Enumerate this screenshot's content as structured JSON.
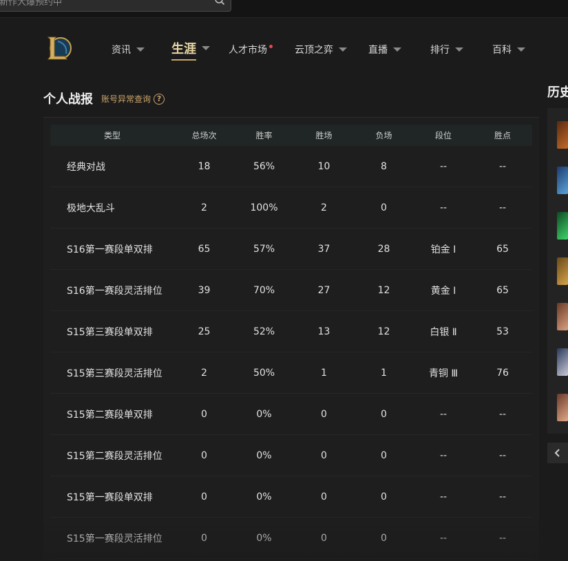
{
  "search": {
    "placeholder": "新作大爆预约中"
  },
  "nav": {
    "items": [
      {
        "label": "资讯"
      },
      {
        "label": "生涯"
      },
      {
        "label": "人才市场"
      },
      {
        "label": "云顶之弈"
      },
      {
        "label": "直播"
      },
      {
        "label": "排行"
      },
      {
        "label": "百科"
      }
    ]
  },
  "page": {
    "title": "个人战报",
    "account_link": "账号异常查询",
    "help_icon_text": "?",
    "right_title": "历史"
  },
  "table": {
    "headers": [
      "类型",
      "总场次",
      "胜率",
      "胜场",
      "负场",
      "段位",
      "胜点"
    ],
    "rows": [
      [
        "经典对战",
        "18",
        "56%",
        "10",
        "8",
        "--",
        "--"
      ],
      [
        "极地大乱斗",
        "2",
        "100%",
        "2",
        "0",
        "--",
        "--"
      ],
      [
        "S16第一赛段单双排",
        "65",
        "57%",
        "37",
        "28",
        "铂金 Ⅰ",
        "65"
      ],
      [
        "S16第一赛段灵活排位",
        "39",
        "70%",
        "27",
        "12",
        "黄金 Ⅰ",
        "65"
      ],
      [
        "S15第三赛段单双排",
        "25",
        "52%",
        "13",
        "12",
        "白银 Ⅱ",
        "53"
      ],
      [
        "S15第三赛段灵活排位",
        "2",
        "50%",
        "1",
        "1",
        "青铜 Ⅲ",
        "76"
      ],
      [
        "S15第二赛段单双排",
        "0",
        "0%",
        "0",
        "0",
        "--",
        "--"
      ],
      [
        "S15第二赛段灵活排位",
        "0",
        "0%",
        "0",
        "0",
        "--",
        "--"
      ],
      [
        "S15第一赛段单双排",
        "0",
        "0%",
        "0",
        "0",
        "--",
        "--"
      ],
      [
        "S15第一赛段灵活排位",
        "0",
        "0%",
        "0",
        "0",
        "--",
        "--"
      ]
    ]
  },
  "colors": {
    "accent_gold": "#caa66a",
    "notification_dot": "#e8474d",
    "table_header_bg": "#1f2625"
  },
  "icons": {
    "search": "search-icon",
    "logo": "lol-logo",
    "help": "help-icon",
    "prev": "chevron-left-icon"
  }
}
